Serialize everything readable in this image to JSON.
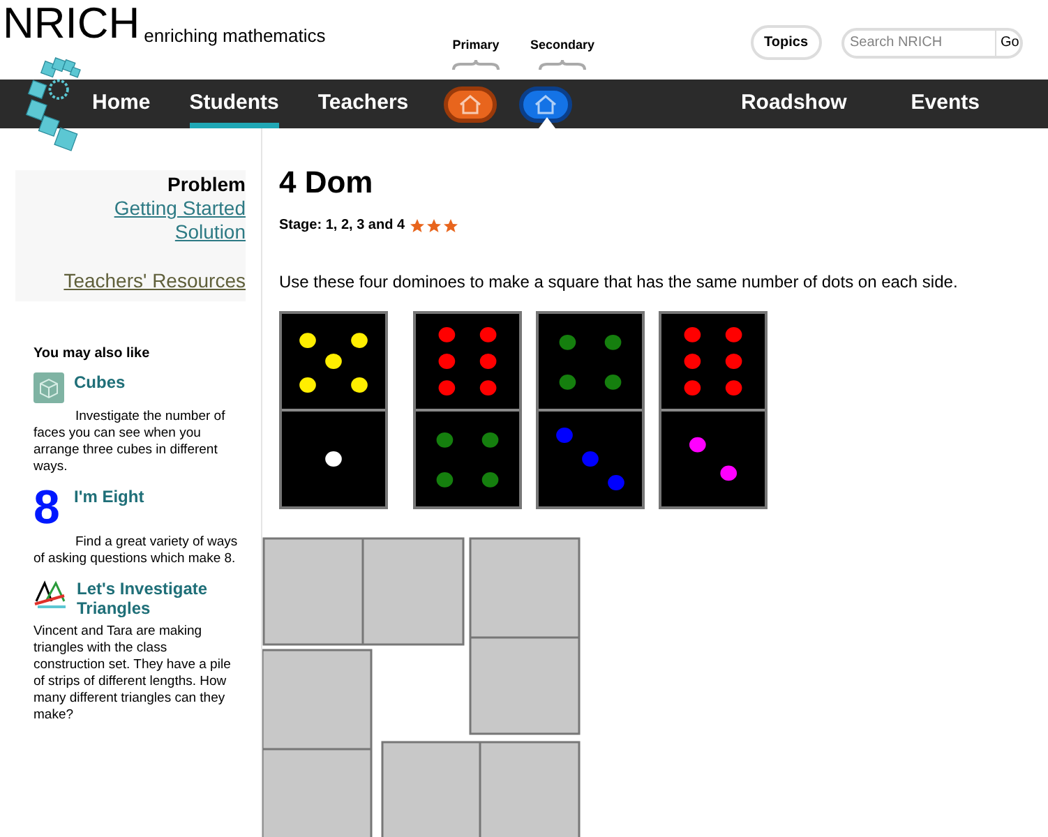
{
  "site": {
    "name": "NRICH",
    "tagline": "enriching mathematics"
  },
  "header": {
    "topics_button": "Topics",
    "search": {
      "placeholder": "Search NRICH"
    },
    "go_button": "Go"
  },
  "nav": {
    "left": [
      {
        "label": "Home",
        "selected": false
      },
      {
        "label": "Students",
        "selected": true
      },
      {
        "label": "Teachers",
        "selected": false
      }
    ],
    "stages": [
      {
        "label": "Primary",
        "kind": "orange",
        "selected": false
      },
      {
        "label": "Secondary",
        "kind": "blue",
        "selected": true
      }
    ],
    "right": [
      {
        "label": "Roadshow",
        "selected": false
      },
      {
        "label": "Events",
        "selected": false
      }
    ]
  },
  "sidebar": {
    "links": [
      {
        "label": "Problem",
        "selected": true
      },
      {
        "label": "Getting Started",
        "selected": false
      },
      {
        "label": "Solution",
        "selected": false
      }
    ],
    "resources_link": "Teachers' Resources",
    "also_like_title": "You may also like",
    "also_like": [
      {
        "kind": "cubes",
        "title": "Cubes",
        "text": "Investigate the number of faces you can see when you arrange three cubes in different ways."
      },
      {
        "kind": "eight",
        "icon_text": "8",
        "title": "I'm Eight",
        "text": "Find a great variety of ways of asking questions which make 8."
      },
      {
        "kind": "triangles",
        "title": "Let's Investigate Triangles",
        "text": "Vincent and Tara are making triangles with the class construction set. They have a pile of strips of different lengths. How many different triangles can they make?"
      }
    ]
  },
  "main": {
    "title": "4 Dom",
    "stage": "Stage: 1, 2, 3 and 4",
    "stars": 3,
    "instructions": "Use these four dominoes to make a square that has the same number of dots on each side.",
    "dominoes": [
      {
        "top": {
          "kind": "five",
          "color": "#ffee00"
        },
        "bottom": {
          "kind": "one",
          "color": "#ffffff"
        }
      },
      {
        "top": {
          "kind": "six",
          "color": "#ff0000"
        },
        "bottom": {
          "kind": "four",
          "color": "#157f0e"
        }
      },
      {
        "top": {
          "kind": "four",
          "color": "#157f0e"
        },
        "bottom": {
          "kind": "three",
          "color": "#0000ff"
        }
      },
      {
        "top": {
          "kind": "six",
          "color": "#ff0000"
        },
        "bottom": {
          "kind": "two",
          "color": "#ff00ff"
        }
      }
    ]
  }
}
